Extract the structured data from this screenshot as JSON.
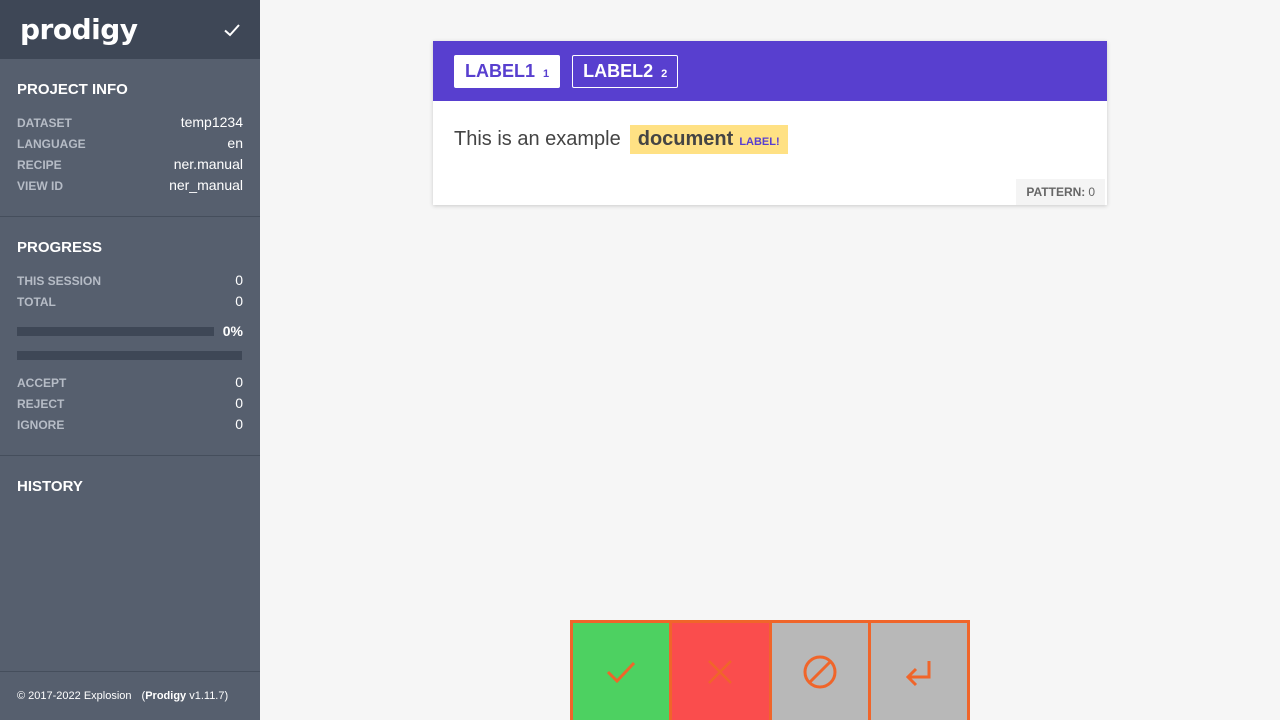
{
  "app": {
    "logo_text": "prodigy"
  },
  "sidebar": {
    "project_info": {
      "title": "PROJECT INFO",
      "rows": [
        {
          "label": "DATASET",
          "value": "temp1234"
        },
        {
          "label": "LANGUAGE",
          "value": "en"
        },
        {
          "label": "RECIPE",
          "value": "ner.manual"
        },
        {
          "label": "VIEW ID",
          "value": "ner_manual"
        }
      ]
    },
    "progress": {
      "title": "PROGRESS",
      "rows": [
        {
          "label": "THIS SESSION",
          "value": "0"
        },
        {
          "label": "TOTAL",
          "value": "0"
        }
      ],
      "percent_text": "0%",
      "percent_value": 0,
      "stats": [
        {
          "label": "ACCEPT",
          "value": "0"
        },
        {
          "label": "REJECT",
          "value": "0"
        },
        {
          "label": "IGNORE",
          "value": "0"
        }
      ]
    },
    "history": {
      "title": "HISTORY"
    },
    "footer": {
      "copyright": "© 2017-2022 Explosion",
      "brand": "Prodigy",
      "version": "v1.11.7"
    }
  },
  "card": {
    "labels": [
      {
        "name": "LABEL1",
        "key": "1",
        "active": true
      },
      {
        "name": "LABEL2",
        "key": "2",
        "active": false
      }
    ],
    "text_before": "This is an example",
    "entity": {
      "text": "document",
      "label": "LABEL!"
    },
    "pattern": {
      "label": "PATTERN:",
      "value": "0"
    }
  },
  "colors": {
    "accent": "#583fcf",
    "accept": "#4dd161",
    "reject": "#fa4d4d",
    "ignore": "#b8b8b8",
    "action_border": "#f0652a",
    "entity_bg": "#ffe184"
  },
  "actions": [
    {
      "name": "accept",
      "icon": "check-icon"
    },
    {
      "name": "reject",
      "icon": "x-icon"
    },
    {
      "name": "ignore",
      "icon": "ban-icon"
    },
    {
      "name": "undo",
      "icon": "undo-arrow-icon"
    }
  ]
}
